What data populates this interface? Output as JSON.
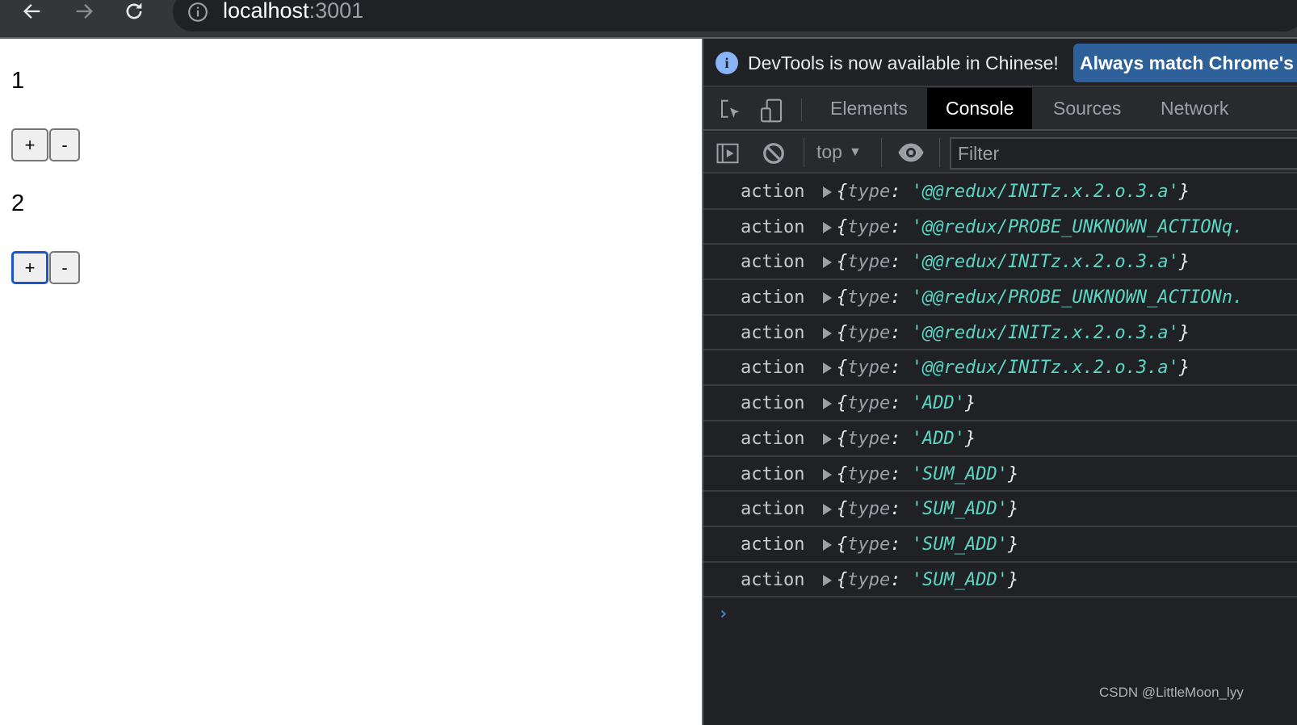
{
  "browser": {
    "url_host": "localhost",
    "url_port": ":3001",
    "icons": [
      "back-arrow-icon",
      "forward-arrow-icon",
      "reload-icon",
      "info-icon"
    ]
  },
  "page": {
    "counters": [
      {
        "value": "1",
        "buttons": [
          "+",
          "-"
        ]
      },
      {
        "value": "2",
        "buttons": [
          "+",
          "-"
        ]
      }
    ]
  },
  "devtools": {
    "banner": {
      "text": "DevTools is now available in Chinese!",
      "button_label": "Always match Chrome's language"
    },
    "tabs": [
      {
        "label": "Elements",
        "active": false
      },
      {
        "label": "Console",
        "active": true
      },
      {
        "label": "Sources",
        "active": false
      },
      {
        "label": "Network",
        "active": false
      }
    ],
    "console_toolbar": {
      "context": "top",
      "filter_placeholder": "Filter"
    },
    "logs": [
      {
        "label": "action",
        "key": "type",
        "value": "'@@redux/INITz.x.2.o.3.a'",
        "closed": true
      },
      {
        "label": "action",
        "key": "type",
        "value": "'@@redux/PROBE_UNKNOWN_ACTIONq.",
        "closed": false
      },
      {
        "label": "action",
        "key": "type",
        "value": "'@@redux/INITz.x.2.o.3.a'",
        "closed": true
      },
      {
        "label": "action",
        "key": "type",
        "value": "'@@redux/PROBE_UNKNOWN_ACTIONn.",
        "closed": false
      },
      {
        "label": "action",
        "key": "type",
        "value": "'@@redux/INITz.x.2.o.3.a'",
        "closed": true
      },
      {
        "label": "action",
        "key": "type",
        "value": "'@@redux/INITz.x.2.o.3.a'",
        "closed": true
      },
      {
        "label": "action",
        "key": "type",
        "value": "'ADD'",
        "closed": true
      },
      {
        "label": "action",
        "key": "type",
        "value": "'ADD'",
        "closed": true
      },
      {
        "label": "action",
        "key": "type",
        "value": "'SUM_ADD'",
        "closed": true
      },
      {
        "label": "action",
        "key": "type",
        "value": "'SUM_ADD'",
        "closed": true
      },
      {
        "label": "action",
        "key": "type",
        "value": "'SUM_ADD'",
        "closed": true
      },
      {
        "label": "action",
        "key": "type",
        "value": "'SUM_ADD'",
        "closed": true
      }
    ],
    "prompt": "›"
  },
  "watermark": "CSDN @LittleMoon_lyy",
  "colors": {
    "string_value": "#5cd5c5",
    "banner_button": "#2e609a",
    "focus_ring": "#1a56c9"
  }
}
